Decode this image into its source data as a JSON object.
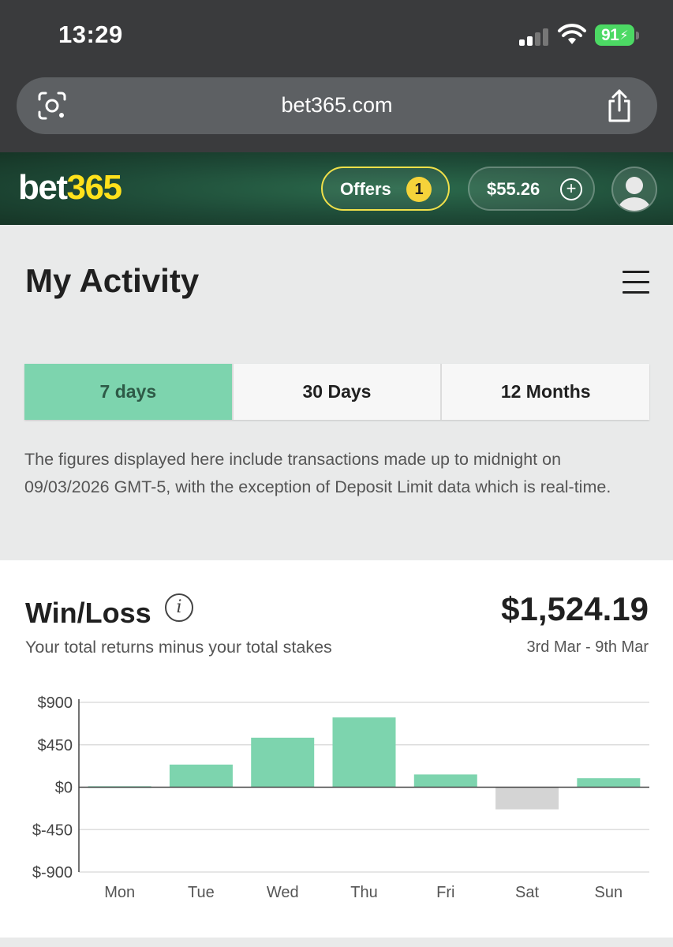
{
  "status_bar": {
    "time": "13:29",
    "battery": "91"
  },
  "browser": {
    "url": "bet365.com"
  },
  "header": {
    "logo_text": "bet",
    "logo_number": "365",
    "offers_label": "Offers",
    "offers_count": "1",
    "balance": "$55.26"
  },
  "page": {
    "title": "My Activity"
  },
  "tabs": [
    {
      "label": "7 days",
      "active": true
    },
    {
      "label": "30 Days",
      "active": false
    },
    {
      "label": "12 Months",
      "active": false
    }
  ],
  "disclaimer": "The figures displayed here include transactions made up to midnight on 09/03/2026 GMT-5, with the exception of Deposit Limit data which is real-time.",
  "win_loss": {
    "title": "Win/Loss",
    "total": "$1,524.19",
    "subtitle": "Your total returns minus your total stakes",
    "date_range": "3rd Mar - 9th Mar"
  },
  "colors": {
    "positive": "#7dd4ae",
    "negative": "#d4d4d4",
    "accent_yellow": "#ffe11b"
  },
  "chart_data": {
    "type": "bar",
    "categories": [
      "Mon",
      "Tue",
      "Wed",
      "Thu",
      "Fri",
      "Sat",
      "Sun"
    ],
    "values": [
      10,
      240,
      525,
      740,
      135,
      -235,
      95
    ],
    "ylim": [
      -900,
      900
    ],
    "ytick_values": [
      900,
      450,
      0,
      -450,
      -900
    ],
    "ytick_labels": [
      "$900",
      "$450",
      "$0",
      "$-450",
      "$-900"
    ],
    "grid": true
  }
}
